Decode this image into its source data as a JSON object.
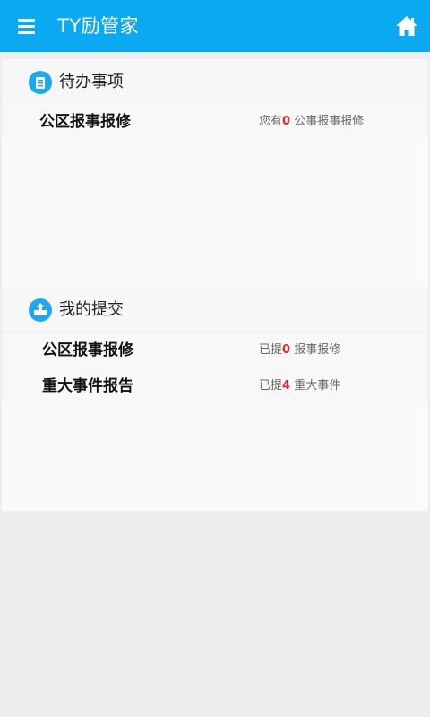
{
  "appbar": {
    "title": "TY励管家",
    "menu_icon": "hamburger-menu-icon",
    "home_icon": "home-icon",
    "background_color": "#0aa9f2"
  },
  "todo": {
    "title": "待办事项",
    "icon": "clipboard-icon",
    "icon_color": "#1ea8f0",
    "items": [
      {
        "label": "公区报事报修",
        "prefix": "您有",
        "count": "0",
        "suffix": " 公事报事报修"
      }
    ]
  },
  "submitted": {
    "title": "我的提交",
    "icon": "submit-icon",
    "icon_color": "#1ea8f0",
    "items": [
      {
        "label": "公区报事报修",
        "prefix": "已提",
        "count": "0",
        "suffix": " 报事报修"
      },
      {
        "label": "重大事件报告",
        "prefix": "已提",
        "count": "4",
        "suffix": " 重大事件"
      }
    ]
  },
  "colors": {
    "count_highlight": "#e8261f",
    "info_text": "#666666"
  }
}
